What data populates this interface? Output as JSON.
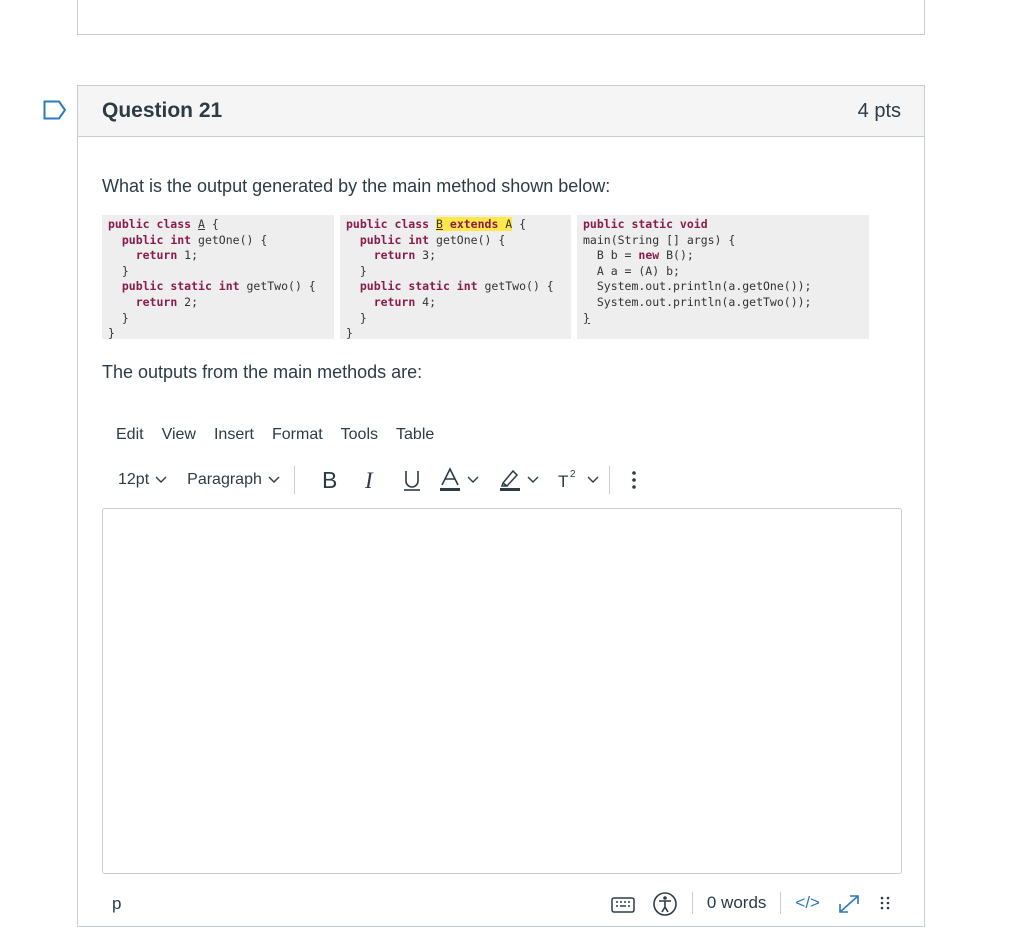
{
  "question": {
    "title": "Question 21",
    "points": "4 pts",
    "prompt": "What is the output generated by the main method shown below:",
    "followup": "The outputs from the main methods are:"
  },
  "code": {
    "class_a": [
      "public class A {",
      "  public int getOne() {",
      "    return 1;",
      "  }",
      "  public static int getTwo() {",
      "    return 2;",
      "  }",
      "}"
    ],
    "class_b": [
      "public class B extends A {",
      "  public int getOne() {",
      "    return 3;",
      "  }",
      "  public static int getTwo() {",
      "    return 4;",
      "  }",
      "}"
    ],
    "main": [
      "public static void",
      "main(String [] args) {",
      "  B b = new B();",
      "  A a = (A) b;",
      "  System.out.println(a.getOne());",
      "  System.out.println(a.getTwo());",
      "}"
    ]
  },
  "editor": {
    "menu": [
      "Edit",
      "View",
      "Insert",
      "Format",
      "Tools",
      "Table"
    ],
    "font_size": "12pt",
    "block_format": "Paragraph",
    "element_path": "p",
    "word_count": "0 words",
    "html_toggle": "</>"
  },
  "colors": {
    "header_bg": "#f5f5f5",
    "border": "#c7cdd1",
    "flag": "#2b7abc",
    "keyword": "#8a1c4b",
    "highlight": "#ffe94a"
  }
}
